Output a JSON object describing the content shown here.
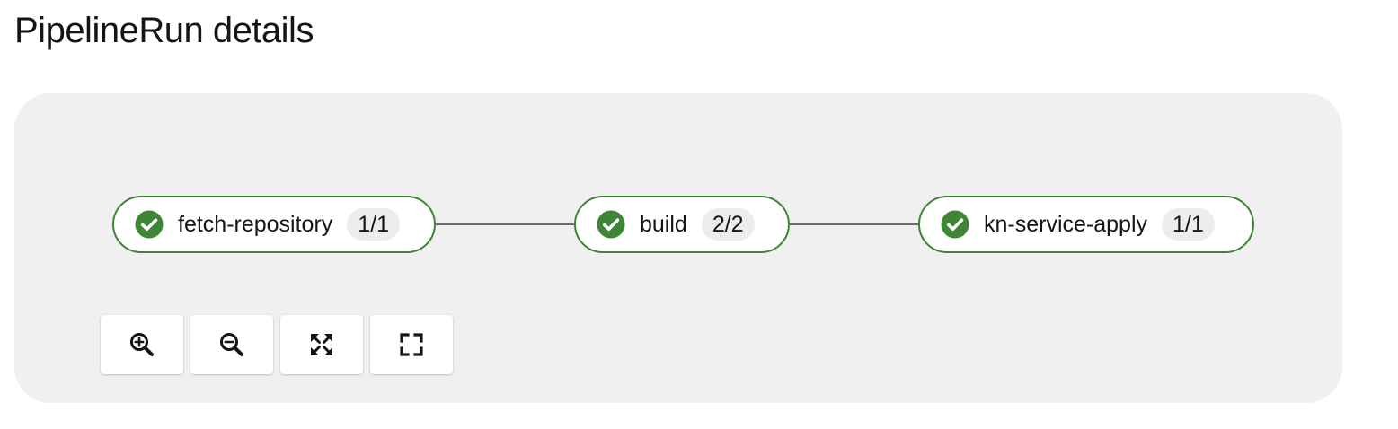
{
  "page": {
    "title": "PipelineRun details"
  },
  "pipeline": {
    "tasks": [
      {
        "name": "fetch-repository",
        "badge": "1/1",
        "status": "succeeded",
        "status_icon": "check-circle-icon"
      },
      {
        "name": "build",
        "badge": "2/2",
        "status": "succeeded",
        "status_icon": "check-circle-icon"
      },
      {
        "name": "kn-service-apply",
        "badge": "1/1",
        "status": "succeeded",
        "status_icon": "check-circle-icon"
      }
    ],
    "colors": {
      "success": "#3e8635",
      "connector": "#6a6e73",
      "canvas": "#f0f0f0"
    }
  },
  "controls": [
    {
      "name": "zoom-in",
      "icon": "zoom-in-icon"
    },
    {
      "name": "zoom-out",
      "icon": "zoom-out-icon"
    },
    {
      "name": "fit-to-screen",
      "icon": "expand-arrows-icon"
    },
    {
      "name": "reset-view",
      "icon": "expand-corners-icon"
    }
  ]
}
